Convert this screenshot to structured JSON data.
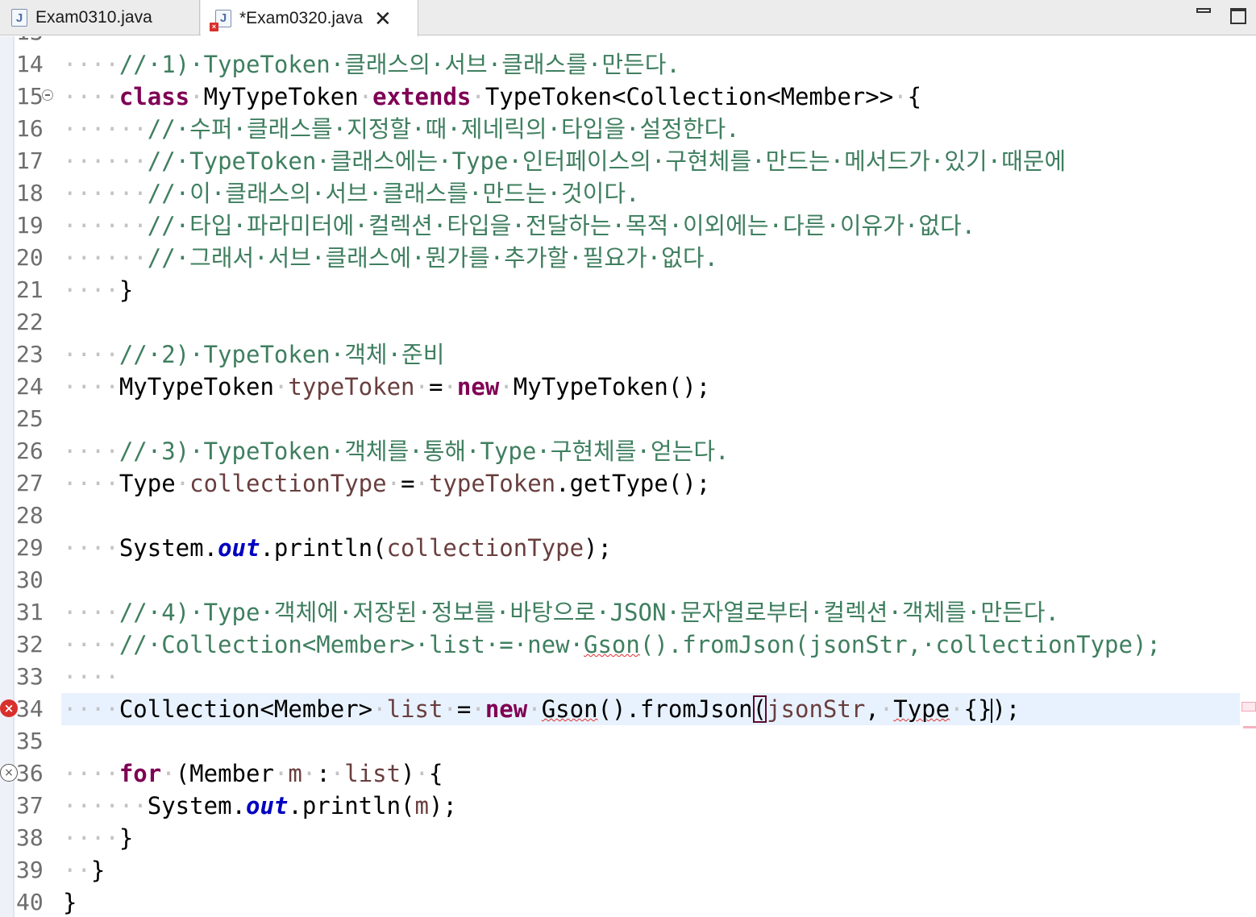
{
  "tabs": [
    {
      "label": "Exam0310.java",
      "active": false,
      "has_error": false
    },
    {
      "label": "*Exam0320.java",
      "active": true,
      "has_error": true,
      "close_glyph": "✕"
    }
  ],
  "colors": {
    "keyword": "#7f0055",
    "comment": "#3f7f5f",
    "field": "#0000c0",
    "variable": "#6a3e3e",
    "line_number": "#6e6e6e",
    "current_line": "#e8f2fe",
    "error": "#d9302c"
  },
  "editor": {
    "partial_top_line": "13",
    "lines": [
      {
        "n": "14",
        "segs": [
          [
            "ws",
            "····"
          ],
          [
            "cm",
            "//·1)·TypeToken·클래스의·서브·클래스를·만든다."
          ]
        ]
      },
      {
        "n": "15",
        "fold": true,
        "segs": [
          [
            "ws",
            "····"
          ],
          [
            "kw",
            "class"
          ],
          [
            "ws",
            "·"
          ],
          [
            "t",
            "MyTypeToken"
          ],
          [
            "ws",
            "·"
          ],
          [
            "kw",
            "extends"
          ],
          [
            "ws",
            "·"
          ],
          [
            "t",
            "TypeToken<Collection<Member>>"
          ],
          [
            "ws",
            "·"
          ],
          [
            "t",
            "{"
          ]
        ]
      },
      {
        "n": "16",
        "segs": [
          [
            "ws",
            "······"
          ],
          [
            "cm",
            "//·수퍼·클래스를·지정할·때·제네릭의·타입을·설정한다."
          ]
        ]
      },
      {
        "n": "17",
        "segs": [
          [
            "ws",
            "······"
          ],
          [
            "cm",
            "//·TypeToken·클래스에는·Type·인터페이스의·구현체를·만드는·메서드가·있기·때문에"
          ]
        ]
      },
      {
        "n": "18",
        "segs": [
          [
            "ws",
            "······"
          ],
          [
            "cm",
            "//·이·클래스의·서브·클래스를·만드는·것이다."
          ]
        ]
      },
      {
        "n": "19",
        "segs": [
          [
            "ws",
            "······"
          ],
          [
            "cm",
            "//·타입·파라미터에·컬렉션·타입을·전달하는·목적·이외에는·다른·이유가·없다."
          ]
        ]
      },
      {
        "n": "20",
        "segs": [
          [
            "ws",
            "······"
          ],
          [
            "cm",
            "//·그래서·서브·클래스에·뭔가를·추가할·필요가·없다."
          ]
        ]
      },
      {
        "n": "21",
        "segs": [
          [
            "ws",
            "····"
          ],
          [
            "t",
            "}"
          ]
        ]
      },
      {
        "n": "22",
        "segs": []
      },
      {
        "n": "23",
        "segs": [
          [
            "ws",
            "····"
          ],
          [
            "cm",
            "//·2)·TypeToken·객체·준비"
          ]
        ]
      },
      {
        "n": "24",
        "segs": [
          [
            "ws",
            "····"
          ],
          [
            "t",
            "MyTypeToken"
          ],
          [
            "ws",
            "·"
          ],
          [
            "var",
            "typeToken"
          ],
          [
            "ws",
            "·"
          ],
          [
            "t",
            "="
          ],
          [
            "ws",
            "·"
          ],
          [
            "kw",
            "new"
          ],
          [
            "ws",
            "·"
          ],
          [
            "t",
            "MyTypeToken();"
          ]
        ]
      },
      {
        "n": "25",
        "segs": []
      },
      {
        "n": "26",
        "segs": [
          [
            "ws",
            "····"
          ],
          [
            "cm",
            "//·3)·TypeToken·객체를·통해·Type·구현체를·얻는다."
          ]
        ]
      },
      {
        "n": "27",
        "segs": [
          [
            "ws",
            "····"
          ],
          [
            "t",
            "Type"
          ],
          [
            "ws",
            "·"
          ],
          [
            "var",
            "collectionType"
          ],
          [
            "ws",
            "·"
          ],
          [
            "t",
            "="
          ],
          [
            "ws",
            "·"
          ],
          [
            "var",
            "typeToken"
          ],
          [
            "t",
            ".getType();"
          ]
        ]
      },
      {
        "n": "28",
        "segs": []
      },
      {
        "n": "29",
        "segs": [
          [
            "ws",
            "····"
          ],
          [
            "t",
            "System."
          ],
          [
            "fld",
            "out"
          ],
          [
            "t",
            ".println("
          ],
          [
            "var",
            "collectionType"
          ],
          [
            "t",
            ");"
          ]
        ]
      },
      {
        "n": "30",
        "segs": []
      },
      {
        "n": "31",
        "segs": [
          [
            "ws",
            "····"
          ],
          [
            "cm",
            "//·4)·Type·객체에·저장된·정보를·바탕으로·JSON·문자열로부터·컬렉션·객체를·만든다."
          ]
        ]
      },
      {
        "n": "32",
        "segs": [
          [
            "ws",
            "····"
          ],
          [
            "cm",
            "//·Collection<Member>·list·=·new·"
          ],
          [
            "cm_err",
            "Gson"
          ],
          [
            "cm",
            "().fromJson(jsonStr,·collectionType);"
          ]
        ]
      },
      {
        "n": "33",
        "segs": [
          [
            "ws",
            "····"
          ]
        ]
      },
      {
        "n": "34",
        "current": true,
        "marker": "error",
        "segs": [
          [
            "ws",
            "····"
          ],
          [
            "t",
            "Collection<Member>"
          ],
          [
            "ws",
            "·"
          ],
          [
            "var",
            "list"
          ],
          [
            "ws",
            "·"
          ],
          [
            "t",
            "="
          ],
          [
            "ws",
            "·"
          ],
          [
            "kw",
            "new"
          ],
          [
            "ws",
            "·"
          ],
          [
            "err",
            "Gson"
          ],
          [
            "t",
            "().fromJson"
          ],
          [
            "br",
            "("
          ],
          [
            "var",
            "jsonStr"
          ],
          [
            "t",
            ","
          ],
          [
            "ws",
            "·"
          ],
          [
            "err",
            "Type"
          ],
          [
            "ws",
            "·"
          ],
          [
            "t",
            "{}"
          ],
          [
            "caret",
            ""
          ],
          [
            "t",
            ");"
          ]
        ]
      },
      {
        "n": "35",
        "segs": []
      },
      {
        "n": "36",
        "marker": "error-outline",
        "segs": [
          [
            "ws",
            "····"
          ],
          [
            "kw",
            "for"
          ],
          [
            "ws",
            "·"
          ],
          [
            "t",
            "(Member"
          ],
          [
            "ws",
            "·"
          ],
          [
            "var",
            "m"
          ],
          [
            "ws",
            "·"
          ],
          [
            "t",
            ":"
          ],
          [
            "ws",
            "·"
          ],
          [
            "var",
            "list"
          ],
          [
            "t",
            ")"
          ],
          [
            "ws",
            "·"
          ],
          [
            "t",
            "{"
          ]
        ]
      },
      {
        "n": "37",
        "segs": [
          [
            "ws",
            "······"
          ],
          [
            "t",
            "System."
          ],
          [
            "fld",
            "out"
          ],
          [
            "t",
            ".println("
          ],
          [
            "var",
            "m"
          ],
          [
            "t",
            ");"
          ]
        ]
      },
      {
        "n": "38",
        "segs": [
          [
            "ws",
            "····"
          ],
          [
            "t",
            "}"
          ]
        ]
      },
      {
        "n": "39",
        "segs": [
          [
            "ws",
            "··"
          ],
          [
            "t",
            "}"
          ]
        ]
      },
      {
        "n": "40",
        "segs": [
          [
            "t",
            "}"
          ]
        ]
      }
    ]
  }
}
